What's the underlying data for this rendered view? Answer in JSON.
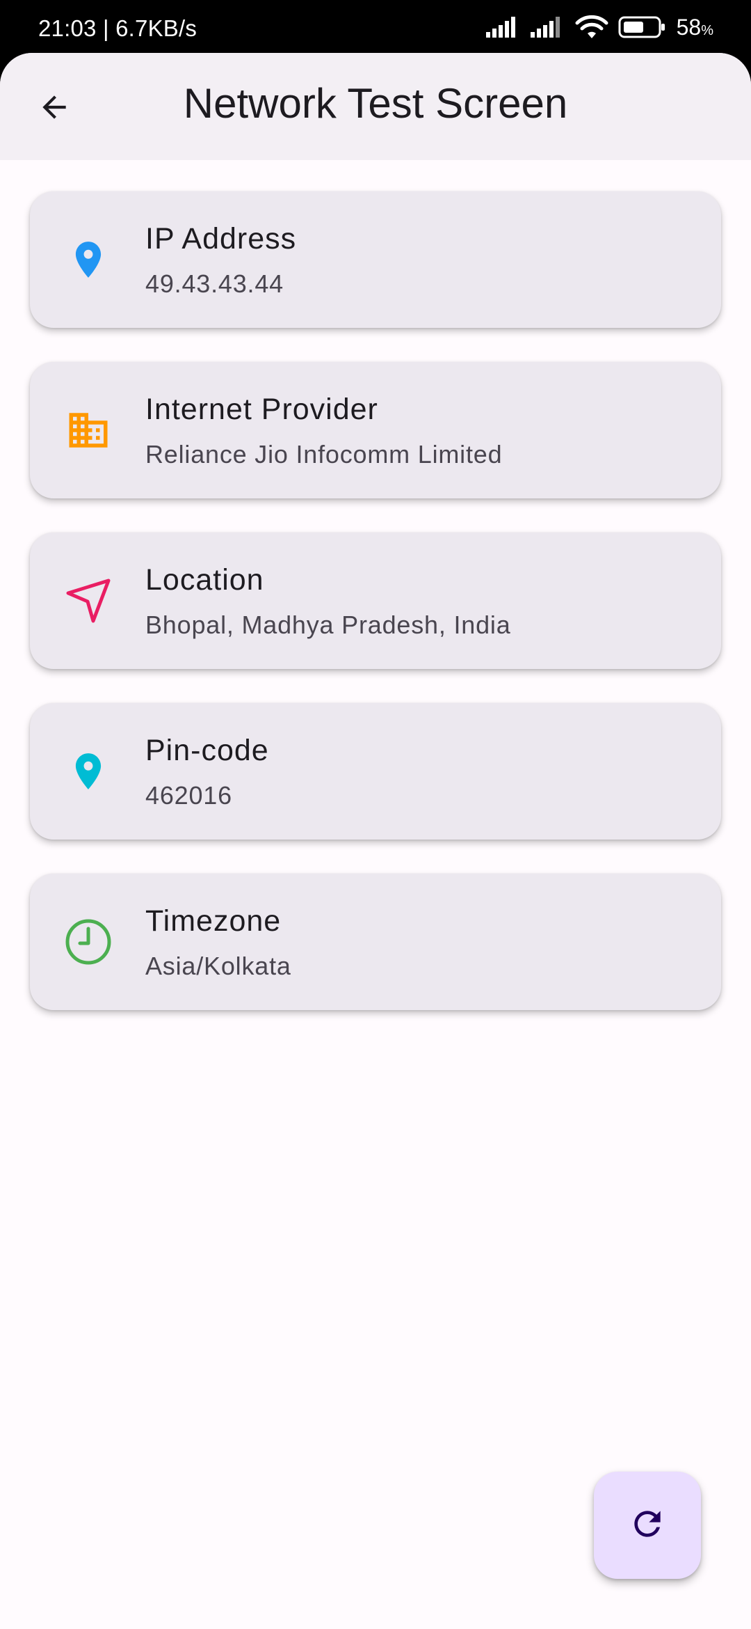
{
  "status_bar": {
    "time_speed": "21:03 | 6.7KB/s",
    "battery_percent": "58",
    "battery_unit": "%",
    "icons": [
      "signal-icon",
      "signal-icon",
      "wifi-icon",
      "battery-icon"
    ]
  },
  "app_bar": {
    "title": "Network Test Screen",
    "back_icon": "arrow-back-icon"
  },
  "cards": [
    {
      "title": "IP Address",
      "value": "49.43.43.44",
      "icon": "location-pin-icon",
      "icon_color": "#2196f3"
    },
    {
      "title": "Internet Provider",
      "value": "Reliance Jio Infocomm Limited",
      "icon": "business-icon",
      "icon_color": "#ff9800"
    },
    {
      "title": "Location",
      "value": "Bhopal, Madhya Pradesh, India",
      "icon": "navigation-icon",
      "icon_color": "#e91e63"
    },
    {
      "title": "Pin-code",
      "value": "462016",
      "icon": "location-pin-icon",
      "icon_color": "#00bcd4"
    },
    {
      "title": "Timezone",
      "value": "Asia/Kolkata",
      "icon": "clock-icon",
      "icon_color": "#4caf50"
    }
  ],
  "fab": {
    "icon": "refresh-icon"
  },
  "colors": {
    "background": "#fffbfe",
    "app_bar": "#f3eff4",
    "card": "#ece8ef",
    "fab": "#eaddff"
  }
}
